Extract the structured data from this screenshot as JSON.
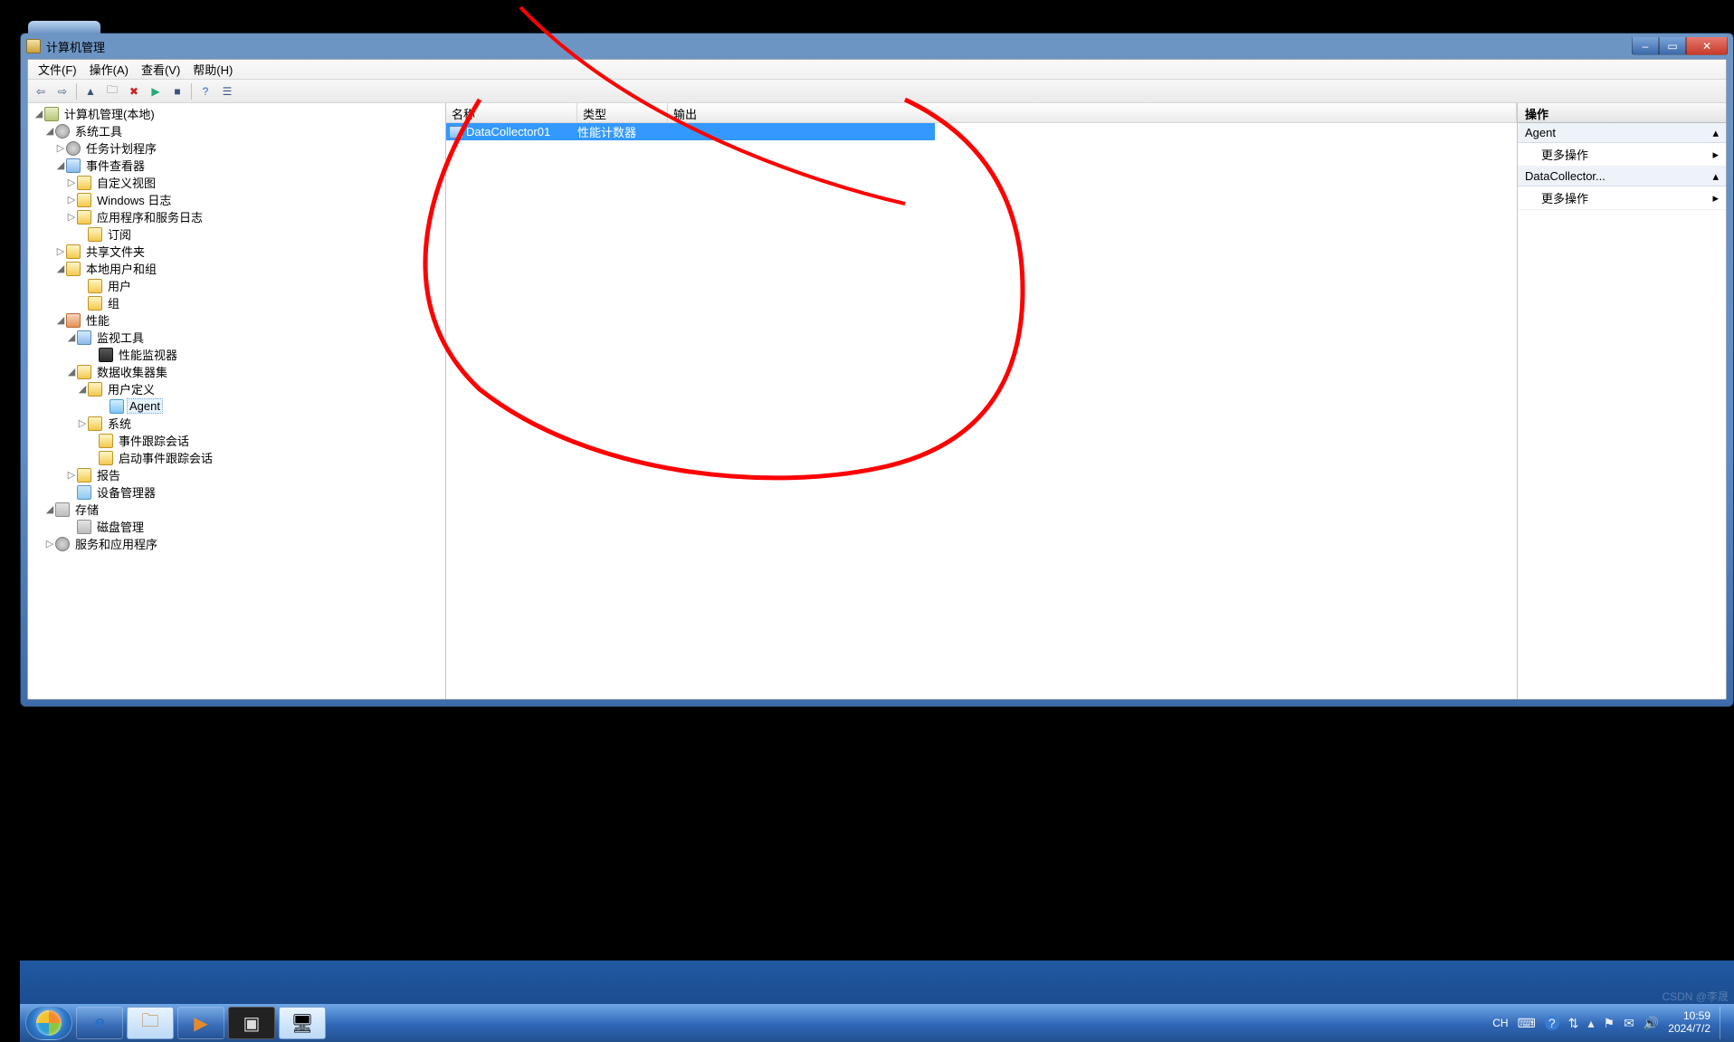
{
  "window": {
    "title": "计算机管理",
    "cap": {
      "min": "–",
      "max": "▭",
      "close": "✕"
    }
  },
  "menu": {
    "file": "文件(F)",
    "action": "操作(A)",
    "view": "查看(V)",
    "help": "帮助(H)"
  },
  "tree": {
    "root": "计算机管理(本地)",
    "sys_tools": "系统工具",
    "task_sched": "任务计划程序",
    "event_viewer": "事件查看器",
    "custom_views": "自定义视图",
    "win_logs": "Windows 日志",
    "app_svc_logs": "应用程序和服务日志",
    "subscribe": "订阅",
    "shared_folders": "共享文件夹",
    "local_users": "本地用户和组",
    "users": "用户",
    "groups": "组",
    "perf": "性能",
    "mon_tools": "监视工具",
    "perf_mon": "性能监视器",
    "dcs": "数据收集器集",
    "user_def": "用户定义",
    "agent": "Agent",
    "system": "系统",
    "ev_trace": "事件跟踪会话",
    "start_ev_trace": "启动事件跟踪会话",
    "reports": "报告",
    "dev_mgr": "设备管理器",
    "storage": "存储",
    "disk_mgmt": "磁盘管理",
    "svc_apps": "服务和应用程序"
  },
  "list": {
    "col_name": "名称",
    "col_type": "类型",
    "col_output": "输出",
    "row": {
      "name": "DataCollector01",
      "type": "性能计数器",
      "output": ""
    }
  },
  "actions": {
    "header": "操作",
    "g1": "Agent",
    "g1_more": "更多操作",
    "g2": "DataCollector...",
    "g2_more": "更多操作",
    "chev": "▸",
    "drop": "▴"
  },
  "tb_icons": {
    "back": "⇦",
    "fwd": "⇨",
    "up": "▲",
    "folder": "🗀",
    "del": "✖",
    "play": "▶",
    "stop": "■",
    "refresh": "⟳",
    "help": "?",
    "prop": "☰"
  },
  "taskbar": {
    "ie": "e",
    "explorer": "🗀",
    "wmp": "▶",
    "cmd": "▣",
    "compmgmt": "🖥",
    "lang": "CH",
    "kb": "⌨",
    "help": "?",
    "net": "⇅",
    "flag": "⚑",
    "msg": "✉",
    "vol": "🔊",
    "time": "10:59",
    "date": "2024/7/2"
  },
  "watermark": "CSDN @李晟"
}
